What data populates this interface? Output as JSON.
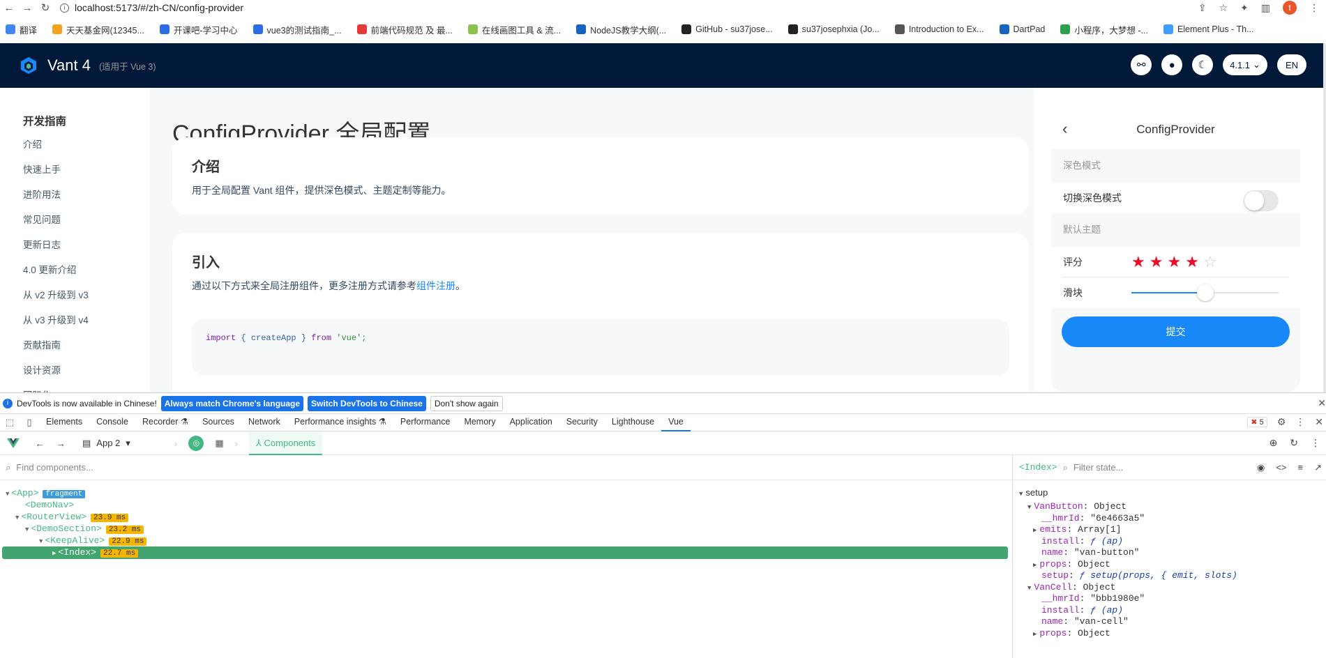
{
  "browser": {
    "url": "localhost:5173/#/zh-CN/config-provider",
    "avatar_letter": "t",
    "bookmarks": [
      "翻译",
      "天天基金网(12345...",
      "开课吧-学习中心",
      "vue3的测试指南_...",
      "前端代码规范 及 最...",
      "在线画图工具 & 流...",
      "NodeJS教学大纲(...",
      "GitHub - su37jose...",
      "su37josephxia (Jo...",
      "Introduction to Ex...",
      "DartPad",
      "小程序，大梦想 -...",
      "Element Plus - Th..."
    ],
    "bookmark_colors": [
      "#4285f4",
      "#f4a21b",
      "#2b6de8",
      "#2b6de8",
      "#e53935",
      "#8bc34a",
      "#1565c0",
      "#222222",
      "#222222",
      "#555555",
      "#1565c0",
      "#2e9e4f",
      "#409eff"
    ]
  },
  "vant": {
    "title": "Vant 4",
    "subtitle": "(适用于 Vue 3)",
    "version": "4.1.1",
    "lang": "EN",
    "brand_color": "#001938"
  },
  "sidebar": {
    "group": "开发指南",
    "items": [
      "介绍",
      "快速上手",
      "进阶用法",
      "常见问题",
      "更新日志",
      "4.0 更新介绍",
      "从 v2 升级到 v3",
      "从 v3 升级到 v4",
      "贡献指南",
      "设计资源",
      "国际化"
    ]
  },
  "doc": {
    "title": "ConfigProvider 全局配置",
    "intro_heading": "介绍",
    "intro_text": "用于全局配置 Vant 组件，提供深色模式、主题定制等能力。",
    "import_heading": "引入",
    "import_text": "通过以下方式来全局注册组件，更多注册方式请参考",
    "import_link": "组件注册",
    "import_end": "。",
    "code_kw1": "import",
    "code_mid": " { createApp } ",
    "code_kw2": "from",
    "code_str": " 'vue';"
  },
  "simulator": {
    "title": "ConfigProvider",
    "dark_block": "深色模式",
    "dark_toggle_label": "切换深色模式",
    "dark_enabled": false,
    "default_block": "默认主题",
    "rate_label": "评分",
    "rate_value": 4,
    "rate_max": 5,
    "slider_label": "滑块",
    "slider_value": 50,
    "submit_label": "提交",
    "accent": "#1989fa"
  },
  "devtools": {
    "banner_text": "DevTools is now available in Chinese!",
    "banner_btn1": "Always match Chrome's language",
    "banner_btn2": "Switch DevTools to Chinese",
    "banner_btn3": "Don't show again",
    "tabs": [
      "Elements",
      "Console",
      "Recorder ⚗",
      "Sources",
      "Network",
      "Performance insights ⚗",
      "Performance",
      "Memory",
      "Application",
      "Security",
      "Lighthouse",
      "Vue"
    ],
    "active_tab": "Vue",
    "error_count": "5",
    "vue": {
      "app_label": "App 2",
      "components_label": "Components",
      "find_placeholder": "Find components...",
      "tree": [
        {
          "label": "<App>",
          "tag": "fragment"
        },
        {
          "label": "<DemoNav>",
          "tag": ""
        },
        {
          "label": "<RouterView>",
          "tag": "23.9 ms"
        },
        {
          "label": "<DemoSection>",
          "tag": "23.2 ms"
        },
        {
          "label": "<KeepAlive>",
          "tag": "22.9 ms"
        },
        {
          "label": "<Index>",
          "tag": "22.7 ms"
        }
      ],
      "state_component": "<Index>",
      "filter_placeholder": "Filter state...",
      "state_section": "setup",
      "state_lines": [
        {
          "key": "VanButton",
          "val": "Object"
        },
        {
          "key": "__hmrId",
          "val": "\"6e4663a5\""
        },
        {
          "key": "emits",
          "val": "Array[1]"
        },
        {
          "key": "install",
          "val": "ƒ (ap)"
        },
        {
          "key": "name",
          "val": "\"van-button\""
        },
        {
          "key": "props",
          "val": "Object"
        },
        {
          "key": "setup",
          "val": "ƒ setup(props, { emit, slots)"
        },
        {
          "key": "VanCell",
          "val": "Object"
        },
        {
          "key": "__hmrId",
          "val": "\"bbb1980e\""
        },
        {
          "key": "install",
          "val": "ƒ (ap)"
        },
        {
          "key": "name",
          "val": "\"van-cell\""
        },
        {
          "key": "props",
          "val": "Object"
        }
      ]
    }
  }
}
